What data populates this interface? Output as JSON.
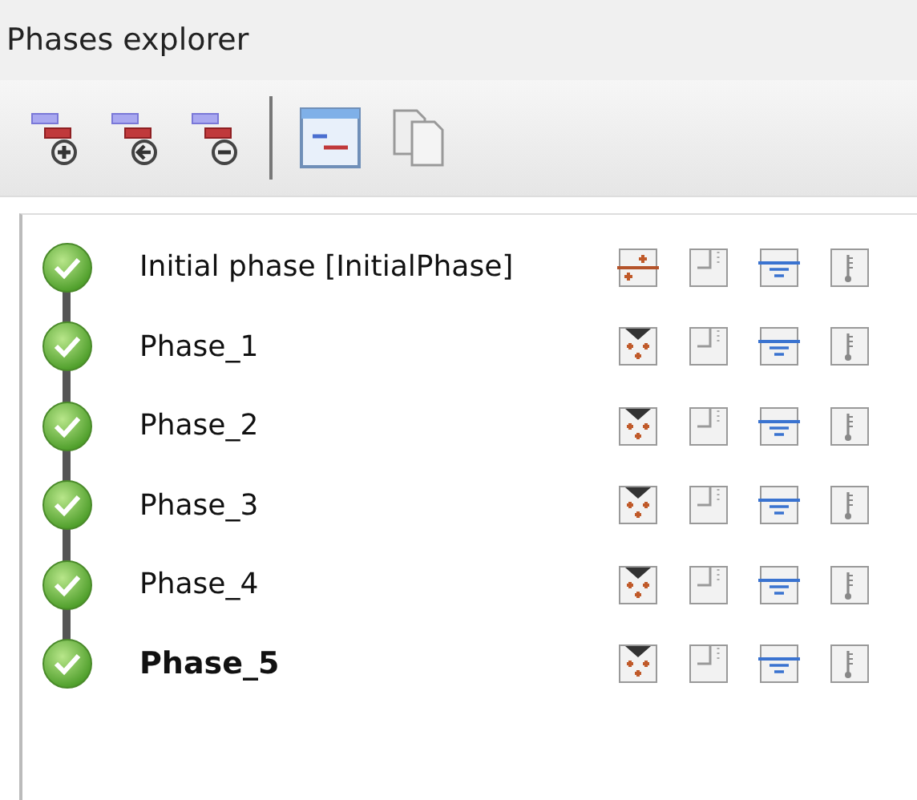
{
  "panel": {
    "title": "Phases explorer"
  },
  "toolbar": [
    {
      "kind": "add"
    },
    {
      "kind": "insert"
    },
    {
      "kind": "remove"
    },
    {
      "kind": "separator"
    },
    {
      "kind": "view"
    },
    {
      "kind": "copy"
    }
  ],
  "phases": [
    {
      "name": "Initial phase [InitialPhase]",
      "kind": "initial",
      "completed": true,
      "selected": false
    },
    {
      "name": "Phase_1",
      "kind": "staged",
      "completed": true,
      "selected": false
    },
    {
      "name": "Phase_2",
      "kind": "staged",
      "completed": true,
      "selected": false
    },
    {
      "name": "Phase_3",
      "kind": "staged",
      "completed": true,
      "selected": false
    },
    {
      "name": "Phase_4",
      "kind": "staged",
      "completed": true,
      "selected": false
    },
    {
      "name": "Phase_5",
      "kind": "staged",
      "completed": true,
      "selected": true
    }
  ]
}
